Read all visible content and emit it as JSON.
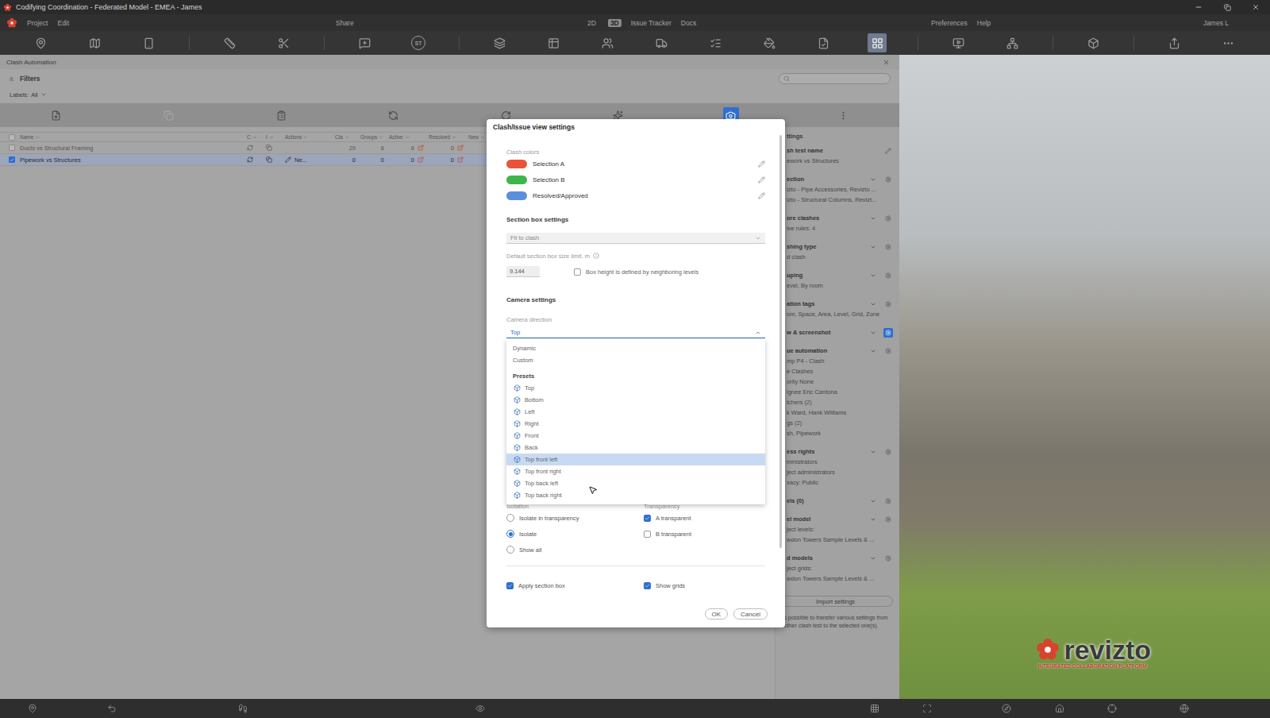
{
  "window": {
    "title": "Codifying Coordination - Federated Model - EMEA - James"
  },
  "menu": {
    "left": [
      "Project",
      "Edit"
    ],
    "share": "Share",
    "views": [
      {
        "label": "2D",
        "selected": false
      },
      {
        "label": "3D",
        "selected": true
      }
    ],
    "modules": [
      "Issue Tracker",
      "Docs"
    ],
    "right": [
      "Preferences",
      "Help"
    ],
    "user": "James L"
  },
  "toolbar": [
    {
      "selected": false
    },
    {
      "selected": false
    },
    {
      "selected": false
    },
    {
      "selected": false
    },
    {
      "selected": false
    },
    {
      "selected": false
    },
    {
      "selected": false,
      "label": "ST"
    },
    {
      "selected": false
    },
    {
      "selected": false
    },
    {
      "selected": false
    },
    {
      "selected": false
    },
    {
      "selected": false
    },
    {
      "selected": false
    },
    {
      "selected": false
    },
    {
      "selected": true
    },
    {
      "selected": false
    },
    {
      "selected": false
    },
    {
      "selected": false
    },
    {
      "selected": false
    },
    {
      "selected": false
    }
  ],
  "panel": {
    "title": "Clash Automation",
    "filters": "Filters",
    "labels": {
      "label": "Labels:",
      "value": "All"
    },
    "toolbar": [
      {
        "selected": false,
        "disabled": false
      },
      {
        "selected": false,
        "disabled": true
      },
      {
        "selected": false,
        "disabled": false
      },
      {
        "selected": false,
        "disabled": false
      },
      {
        "selected": false,
        "disabled": false
      },
      {
        "selected": false,
        "disabled": false
      },
      {
        "selected": true,
        "disabled": false
      },
      {
        "selected": false,
        "disabled": false
      }
    ],
    "columns": [
      "Name",
      "C",
      "I",
      "Actions",
      "Cla",
      "Groups",
      "Active",
      "Resolved",
      "New"
    ],
    "rows": [
      {
        "checked": false,
        "selected": false,
        "name": "Ducts vs Structural Framing",
        "action": "",
        "clashes": "29",
        "groups": "6",
        "active": "6",
        "resolved": "0"
      },
      {
        "checked": true,
        "selected": true,
        "name": "Pipework vs Structures",
        "action": "Ne...",
        "clashes": "0",
        "groups": "0",
        "active": "0",
        "resolved": "0"
      }
    ]
  },
  "settings": {
    "header": "ttings",
    "sections": [
      {
        "title": "sh test name",
        "kind": "edit",
        "highlighted": false,
        "values": [
          "ework vs Structures"
        ]
      },
      {
        "title": "ection",
        "kind": "expand",
        "highlighted": false,
        "values": [
          "izto - Pipe Accessories, Revizto ...",
          "izto - Structural Columns, Revizt..."
        ]
      },
      {
        "title": "ore clashes",
        "kind": "expand",
        "highlighted": false,
        "values": [
          "ive rules: 4"
        ]
      },
      {
        "title": "shing type",
        "kind": "expand",
        "highlighted": false,
        "values": [
          "d clash"
        ]
      },
      {
        "title": "uping",
        "kind": "expand",
        "highlighted": false,
        "values": [
          "evel, By room"
        ]
      },
      {
        "title": "ation tags",
        "kind": "expand",
        "highlighted": false,
        "values": [
          "om, Space, Area, Level, Grid, Zone"
        ]
      },
      {
        "title": "w & screenshot",
        "kind": "expand",
        "highlighted": true,
        "values": []
      },
      {
        "title": "ue automation",
        "kind": "expand",
        "highlighted": false,
        "values": [
          "mp P4 - Clash",
          "e Clashes",
          "ority None",
          "ignee Eric Cantona",
          "tchers (2)",
          "k Ward, Hank Williams",
          "gs (2)",
          "sh, Pipework"
        ]
      },
      {
        "title": "ess rights",
        "kind": "expand",
        "highlighted": false,
        "values": [
          "ministrators",
          "ject administrators",
          "vacy: Public"
        ]
      },
      {
        "title": "els (0)",
        "kind": "expand",
        "highlighted": false,
        "values": []
      },
      {
        "title": "el model",
        "kind": "expand",
        "highlighted": false,
        "values": [
          "ject levels:",
          "wdon Towers Sample Levels & ..."
        ]
      },
      {
        "title": "d models",
        "kind": "expand",
        "highlighted": false,
        "values": [
          "ject grids:",
          "wdon Towers Sample Levels & ..."
        ]
      }
    ],
    "import_button": "Import settings",
    "note": "It is possible to transfer various settings from another clash test to the selected one(s)."
  },
  "modal": {
    "title": "Clash/Issue view settings",
    "clash_colors": {
      "label": "Clash colors",
      "items": [
        {
          "label": "Selection A",
          "color": "#e8533a"
        },
        {
          "label": "Selection B",
          "color": "#3db54a"
        },
        {
          "label": "Resolved/Approved",
          "color": "#5a8fdc"
        }
      ]
    },
    "section_box": {
      "title": "Section box settings",
      "mode": "Fit to clash",
      "size_label": "Default section box size limit, m",
      "size": "9.144",
      "neighbor_levels": {
        "label": "Box height is defined by neighboring levels",
        "checked": false
      }
    },
    "camera": {
      "title": "Camera settings",
      "direction_label": "Camera direction",
      "direction": "Top",
      "open": true,
      "options": [
        {
          "label": "Dynamic",
          "kind": "option",
          "highlighted": false
        },
        {
          "label": "Custom",
          "kind": "option",
          "highlighted": false
        },
        {
          "label": "Presets",
          "kind": "heading",
          "highlighted": false
        },
        {
          "label": "Top",
          "kind": "preset",
          "highlighted": false
        },
        {
          "label": "Bottom",
          "kind": "preset",
          "highlighted": false
        },
        {
          "label": "Left",
          "kind": "preset",
          "highlighted": false
        },
        {
          "label": "Right",
          "kind": "preset",
          "highlighted": false
        },
        {
          "label": "Front",
          "kind": "preset",
          "highlighted": false
        },
        {
          "label": "Back",
          "kind": "preset",
          "highlighted": false
        },
        {
          "label": "Top front left",
          "kind": "preset",
          "highlighted": true
        },
        {
          "label": "Top front right",
          "kind": "preset",
          "highlighted": false
        },
        {
          "label": "Top back left",
          "kind": "preset",
          "highlighted": false
        },
        {
          "label": "Top back right",
          "kind": "preset",
          "highlighted": false
        }
      ]
    },
    "isolation": {
      "label": "Isolation",
      "options": [
        {
          "label": "Isolate in transparency",
          "selected": false
        },
        {
          "label": "Isolate",
          "selected": true
        },
        {
          "label": "Show all",
          "selected": false
        }
      ]
    },
    "transparency": {
      "label": "Transparency",
      "options": [
        {
          "label": "A transparent",
          "checked": true
        },
        {
          "label": "B transparent",
          "checked": false
        }
      ]
    },
    "apply_section_box": {
      "label": "Apply section box",
      "checked": true
    },
    "show_grids": {
      "label": "Show grids",
      "checked": true
    },
    "buttons": [
      "OK",
      "Cancel"
    ]
  },
  "viewport": {
    "logo": {
      "name": "revizto",
      "tagline": "INTEGRATED COLLABORATION PLATFORM"
    }
  }
}
